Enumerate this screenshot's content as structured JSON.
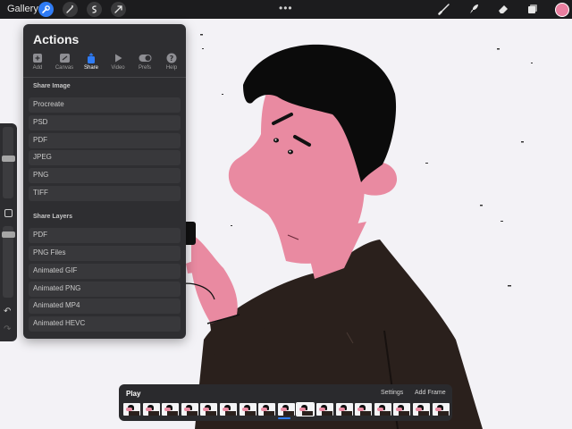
{
  "topbar": {
    "gallery_label": "Gallery",
    "menu_dots": "•••",
    "left_tools": [
      "wrench-icon",
      "magic-wand-icon",
      "selection-icon",
      "transform-arrow-icon"
    ],
    "right_tools": [
      "brush-icon",
      "smudge-icon",
      "eraser-icon",
      "layers-icon"
    ],
    "current_color": "#ea7fa0"
  },
  "actions": {
    "title": "Actions",
    "tabs": [
      {
        "label": "Add",
        "icon": "add-icon"
      },
      {
        "label": "Canvas",
        "icon": "canvas-icon"
      },
      {
        "label": "Share",
        "icon": "share-icon",
        "active": true
      },
      {
        "label": "Video",
        "icon": "video-icon"
      },
      {
        "label": "Prefs",
        "icon": "toggle-icon"
      },
      {
        "label": "Help",
        "icon": "help-icon"
      }
    ],
    "share_image": {
      "heading": "Share Image",
      "items": [
        "Procreate",
        "PSD",
        "PDF",
        "JPEG",
        "PNG",
        "TIFF"
      ]
    },
    "share_layers": {
      "heading": "Share Layers",
      "items": [
        "PDF",
        "PNG Files",
        "Animated GIF",
        "Animated PNG",
        "Animated MP4",
        "Animated HEVC"
      ]
    }
  },
  "animation": {
    "play_label": "Play",
    "settings_label": "Settings",
    "add_frame_label": "Add Frame",
    "frame_count": 17,
    "current_frame": 9
  },
  "colors": {
    "accent": "#2f7cf6",
    "skin": "#e98aa1",
    "hair": "#0b0b0b",
    "sweater": "#2a201c",
    "panel": "#2e2e31"
  }
}
